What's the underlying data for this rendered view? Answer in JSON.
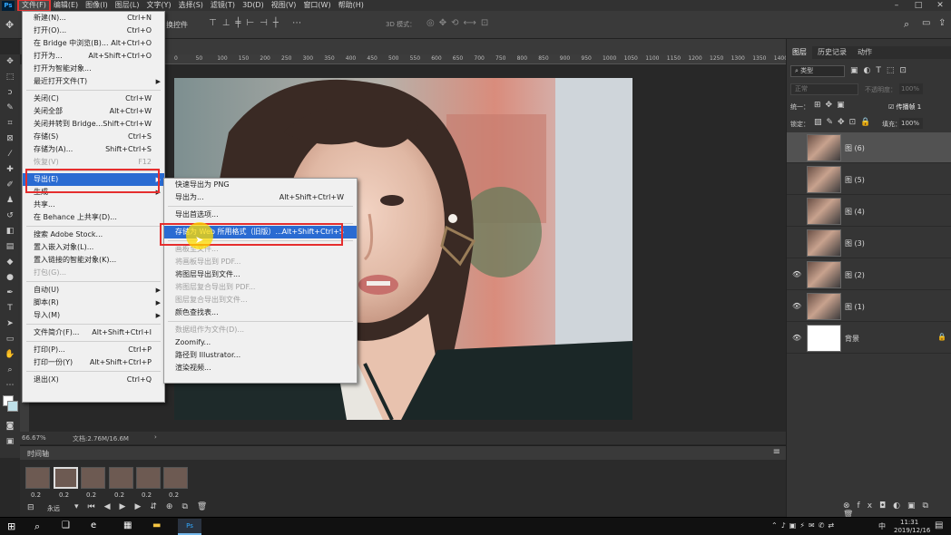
{
  "menubar": {
    "items": [
      "文件(F)",
      "编辑(E)",
      "图像(I)",
      "图层(L)",
      "文字(Y)",
      "选择(S)",
      "滤镜(T)",
      "3D(D)",
      "视图(V)",
      "窗口(W)",
      "帮助(H)"
    ],
    "logo": "Ps"
  },
  "optbar": {
    "label": "换控件",
    "mode3d": "3D 模式："
  },
  "file_menu": {
    "items": [
      {
        "label": "新建(N)...",
        "shortcut": "Ctrl+N",
        "disabled": false
      },
      {
        "label": "打开(O)...",
        "shortcut": "Ctrl+O",
        "disabled": false
      },
      {
        "label": "在 Bridge 中浏览(B)...",
        "shortcut": "Alt+Ctrl+O",
        "disabled": false
      },
      {
        "label": "打开为...",
        "shortcut": "Alt+Shift+Ctrl+O",
        "disabled": false
      },
      {
        "label": "打开为智能对象...",
        "shortcut": "",
        "disabled": false
      },
      {
        "label": "最近打开文件(T)",
        "shortcut": "",
        "disabled": false,
        "submenu": true
      },
      {
        "sep": true
      },
      {
        "label": "关闭(C)",
        "shortcut": "Ctrl+W",
        "disabled": false
      },
      {
        "label": "关闭全部",
        "shortcut": "Alt+Ctrl+W",
        "disabled": false
      },
      {
        "label": "关闭并转到 Bridge...",
        "shortcut": "Shift+Ctrl+W",
        "disabled": false
      },
      {
        "label": "存储(S)",
        "shortcut": "Ctrl+S",
        "disabled": false
      },
      {
        "label": "存储为(A)...",
        "shortcut": "Shift+Ctrl+S",
        "disabled": false
      },
      {
        "label": "恢复(V)",
        "shortcut": "F12",
        "disabled": true
      },
      {
        "sep": true
      },
      {
        "label": "导出(E)",
        "shortcut": "",
        "highlight": true,
        "submenu": true
      },
      {
        "label": "生成",
        "shortcut": "",
        "disabled": false,
        "submenu": true
      },
      {
        "label": "共享...",
        "shortcut": "",
        "disabled": false
      },
      {
        "label": "在 Behance 上共享(D)...",
        "shortcut": "",
        "disabled": false
      },
      {
        "sep": true
      },
      {
        "label": "搜索 Adobe Stock...",
        "shortcut": "",
        "disabled": false
      },
      {
        "label": "置入嵌入对象(L)...",
        "shortcut": "",
        "disabled": false
      },
      {
        "label": "置入链接的智能对象(K)...",
        "shortcut": "",
        "disabled": false
      },
      {
        "label": "打包(G)...",
        "shortcut": "",
        "disabled": true
      },
      {
        "sep": true
      },
      {
        "label": "自动(U)",
        "shortcut": "",
        "disabled": false,
        "submenu": true
      },
      {
        "label": "脚本(R)",
        "shortcut": "",
        "disabled": false,
        "submenu": true
      },
      {
        "label": "导入(M)",
        "shortcut": "",
        "disabled": false,
        "submenu": true
      },
      {
        "sep": true
      },
      {
        "label": "文件简介(F)...",
        "shortcut": "Alt+Shift+Ctrl+I",
        "disabled": false
      },
      {
        "sep": true
      },
      {
        "label": "打印(P)...",
        "shortcut": "Ctrl+P",
        "disabled": false
      },
      {
        "label": "打印一份(Y)",
        "shortcut": "Alt+Shift+Ctrl+P",
        "disabled": false
      },
      {
        "sep": true
      },
      {
        "label": "退出(X)",
        "shortcut": "Ctrl+Q",
        "disabled": false
      }
    ]
  },
  "export_menu": {
    "items": [
      {
        "label": "快速导出为 PNG",
        "shortcut": ""
      },
      {
        "label": "导出为...",
        "shortcut": "Alt+Shift+Ctrl+W"
      },
      {
        "sep": true
      },
      {
        "label": "导出首选项...",
        "shortcut": ""
      },
      {
        "sep": true
      },
      {
        "label": "存储为 Web 所用格式（旧版）...",
        "shortcut": "Alt+Shift+Ctrl+S",
        "highlight": true
      },
      {
        "sep": true
      },
      {
        "label": "画板至文件...",
        "shortcut": "",
        "disabled": true
      },
      {
        "label": "将画板导出到 PDF...",
        "shortcut": "",
        "disabled": true
      },
      {
        "label": "将图层导出到文件...",
        "shortcut": ""
      },
      {
        "label": "将图层复合导出到 PDF...",
        "shortcut": "",
        "disabled": true
      },
      {
        "label": "图层复合导出到文件...",
        "shortcut": "",
        "disabled": true
      },
      {
        "label": "颜色查找表...",
        "shortcut": ""
      },
      {
        "sep": true
      },
      {
        "label": "数据组作为文件(D)...",
        "shortcut": "",
        "disabled": true
      },
      {
        "label": "Zoomify...",
        "shortcut": ""
      },
      {
        "label": "路径到 Illustrator...",
        "shortcut": ""
      },
      {
        "label": "渲染视频...",
        "shortcut": ""
      }
    ]
  },
  "status": {
    "zoom": "66.67%",
    "doc": "文档:2.76M/16.6M"
  },
  "timeline": {
    "title": "时间轴",
    "loop": "永远",
    "delays": [
      "0.2",
      "0.2",
      "0.2",
      "0.2",
      "0.2",
      "0.2"
    ]
  },
  "panels": {
    "tabs": [
      "图层",
      "历史记录",
      "动作"
    ],
    "filter": "类型",
    "blend": "正常",
    "opacity_label": "不透明度：",
    "opacity": "100%",
    "unify": "统一：",
    "propagate": "传播帧 1",
    "lock": "锁定：",
    "fill_label": "填充：",
    "fill": "100%",
    "layers": [
      {
        "name": "图 (6)",
        "visible": false,
        "selected": true
      },
      {
        "name": "图 (5)",
        "visible": false
      },
      {
        "name": "图 (4)",
        "visible": false
      },
      {
        "name": "图 (3)",
        "visible": false
      },
      {
        "name": "图 (2)",
        "visible": true
      },
      {
        "name": "图 (1)",
        "visible": true
      },
      {
        "name": "背景",
        "visible": true,
        "background": true
      }
    ]
  },
  "ruler": {
    "ticks": [
      "0",
      "50",
      "100",
      "150",
      "200",
      "250",
      "300",
      "350",
      "400",
      "450",
      "500",
      "550",
      "600",
      "650",
      "700",
      "750",
      "800",
      "850",
      "900",
      "950",
      "1000",
      "1050",
      "1100",
      "1150",
      "1200",
      "1250",
      "1300",
      "1350",
      "1400",
      "1450"
    ]
  },
  "taskbar": {
    "time": "11:31",
    "date": "2019/12/16",
    "lang": "中"
  }
}
